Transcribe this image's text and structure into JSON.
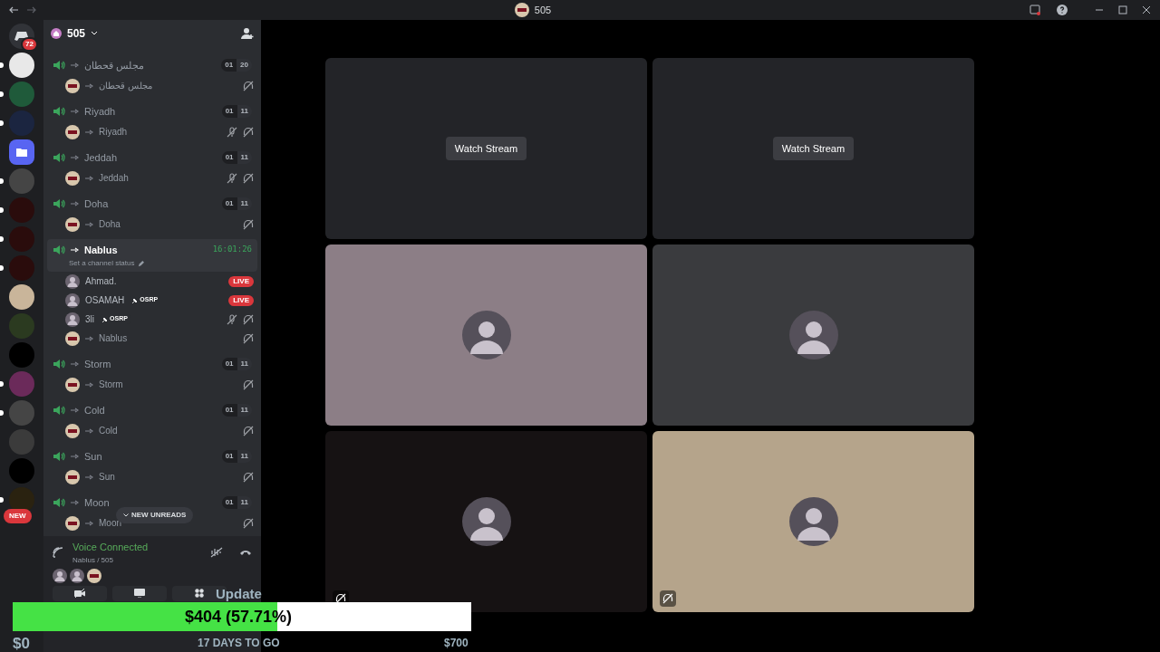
{
  "window": {
    "title": "505"
  },
  "servers": [
    {
      "kind": "home",
      "badge": "72",
      "unread": false,
      "color": "#313338"
    },
    {
      "kind": "server",
      "unread": true,
      "color": "#e8e8e8"
    },
    {
      "kind": "server",
      "unread": true,
      "color": "#1f5a3a"
    },
    {
      "kind": "server",
      "unread": true,
      "color": "#1b2540"
    },
    {
      "kind": "folder",
      "unread": false,
      "color": "#5865f2"
    },
    {
      "kind": "server",
      "unread": true,
      "color": "#454545"
    },
    {
      "kind": "server",
      "unread": true,
      "color": "#2a0c0c"
    },
    {
      "kind": "server",
      "unread": true,
      "color": "#2a0c0c"
    },
    {
      "kind": "server",
      "unread": true,
      "color": "#2a0c0c"
    },
    {
      "kind": "server",
      "unread": false,
      "color": "#c9b59a"
    },
    {
      "kind": "server",
      "unread": false,
      "color": "#2b3a20"
    },
    {
      "kind": "server",
      "unread": false,
      "color": "#000000"
    },
    {
      "kind": "server",
      "unread": true,
      "color": "#6b2a5a"
    },
    {
      "kind": "server",
      "unread": true,
      "color": "#454545"
    },
    {
      "kind": "server",
      "unread": false,
      "color": "#3b3b3b"
    },
    {
      "kind": "server",
      "unread": false,
      "color": "#000000"
    },
    {
      "kind": "server",
      "unread": true,
      "color": "#2a2210"
    }
  ],
  "new_label": "NEW",
  "server_header": {
    "name": "505"
  },
  "channels": [
    {
      "name": "مجلس قحطان",
      "selected": false,
      "count_a": "01",
      "count_b": "20",
      "members": [
        {
          "kind": "bot",
          "name": "مجلس قحطان",
          "muted": false,
          "deafened": true
        }
      ]
    },
    {
      "name": "Riyadh",
      "selected": false,
      "count_a": "01",
      "count_b": "11",
      "members": [
        {
          "kind": "bot",
          "name": "Riyadh",
          "muted": true,
          "deafened": true
        }
      ]
    },
    {
      "name": "Jeddah",
      "selected": false,
      "count_a": "01",
      "count_b": "11",
      "members": [
        {
          "kind": "bot",
          "name": "Jeddah",
          "muted": true,
          "deafened": true
        }
      ]
    },
    {
      "name": "Doha",
      "selected": false,
      "count_a": "01",
      "count_b": "11",
      "members": [
        {
          "kind": "bot",
          "name": "Doha",
          "muted": false,
          "deafened": true
        }
      ]
    },
    {
      "name": "Nablus",
      "selected": true,
      "timer": "16:01:26",
      "status": "Set a channel status",
      "members": [
        {
          "kind": "user",
          "name": "Ahmad.",
          "live": "LIVE",
          "muted": false,
          "deafened": false
        },
        {
          "kind": "user",
          "name": "OSAMAH",
          "tag": "OSRP",
          "live": "LIVE",
          "muted": false,
          "deafened": false
        },
        {
          "kind": "user",
          "name": "3li",
          "tag": "OSRP",
          "muted": true,
          "deafened": true
        },
        {
          "kind": "bot",
          "name": "Nablus",
          "muted": false,
          "deafened": true
        }
      ]
    },
    {
      "name": "Storm",
      "selected": false,
      "count_a": "01",
      "count_b": "11",
      "members": [
        {
          "kind": "bot",
          "name": "Storm",
          "muted": false,
          "deafened": true
        }
      ]
    },
    {
      "name": "Cold",
      "selected": false,
      "count_a": "01",
      "count_b": "11",
      "members": [
        {
          "kind": "bot",
          "name": "Cold",
          "muted": false,
          "deafened": true
        }
      ]
    },
    {
      "name": "Sun",
      "selected": false,
      "count_a": "01",
      "count_b": "11",
      "members": [
        {
          "kind": "bot",
          "name": "Sun",
          "muted": false,
          "deafened": true
        }
      ]
    },
    {
      "name": "Moon",
      "selected": false,
      "count_a": "01",
      "count_b": "11",
      "members": [
        {
          "kind": "bot",
          "name": "Moon",
          "muted": false,
          "deafened": true
        }
      ]
    }
  ],
  "new_unreads": "NEW UNREADS",
  "voice_panel": {
    "status": "Voice Connected",
    "location": "Nablus / 505"
  },
  "tiles": [
    {
      "kind": "stream",
      "button": "Watch Stream",
      "color": "#232428",
      "muted": false
    },
    {
      "kind": "stream",
      "button": "Watch Stream",
      "color": "#232428",
      "muted": false
    },
    {
      "kind": "avatar",
      "color": "#8c7e86",
      "muted": false
    },
    {
      "kind": "avatar",
      "color": "#3a3b3e",
      "muted": false
    },
    {
      "kind": "avatar",
      "color": "#161213",
      "muted": true
    },
    {
      "kind": "avatar",
      "color": "#b5a48b",
      "muted": true
    }
  ],
  "overlay": {
    "update": "Update",
    "amount": "$404 (57.71%)",
    "level": 0.5771,
    "start": "$0",
    "days": "17 DAYS TO GO",
    "goal": "$700"
  }
}
